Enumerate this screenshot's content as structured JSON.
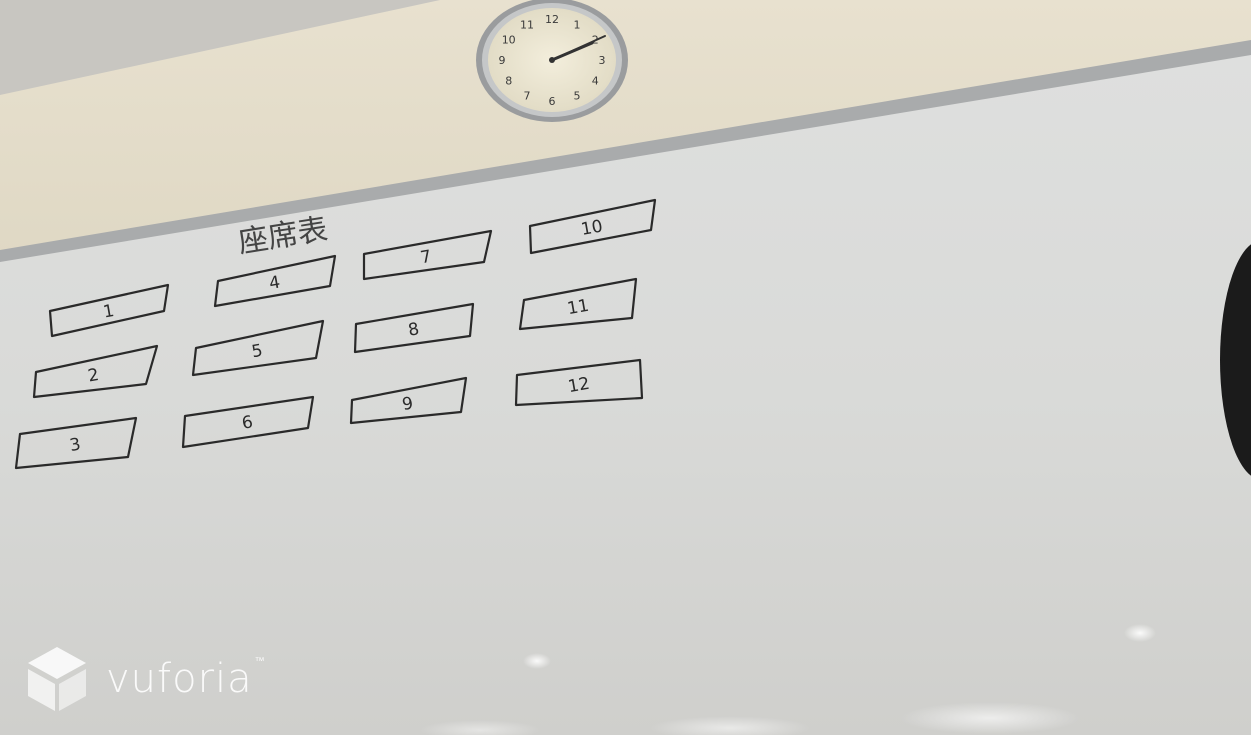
{
  "board": {
    "title": "座席表",
    "seats": [
      {
        "label": "1"
      },
      {
        "label": "2"
      },
      {
        "label": "3"
      },
      {
        "label": "4"
      },
      {
        "label": "5"
      },
      {
        "label": "6"
      },
      {
        "label": "7"
      },
      {
        "label": "8"
      },
      {
        "label": "9"
      },
      {
        "label": "10"
      },
      {
        "label": "11"
      },
      {
        "label": "12"
      }
    ]
  },
  "clock": {
    "numerals": [
      "12",
      "1",
      "2",
      "3",
      "4",
      "5",
      "6",
      "7",
      "8",
      "9",
      "10",
      "11"
    ],
    "time": "2:10"
  },
  "brand": {
    "name": "vuforia",
    "mark": "™"
  },
  "colors": {
    "wall": "#e6dfcc",
    "board": "#dcdcd9",
    "ink": "#2a2a2a",
    "ceiling": "#c9c7c2"
  }
}
